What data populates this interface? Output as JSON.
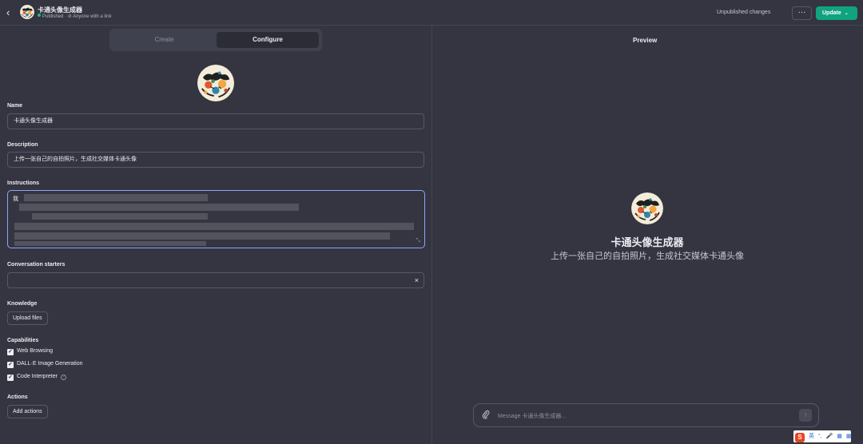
{
  "header": {
    "back_icon": "chevron-left-icon",
    "gpt_name": "卡通头像生成器",
    "status": "Published",
    "status_color": "#19c37d",
    "visibility": "Anyone with a link",
    "unpublished": "Unpublished changes",
    "more_label": "···",
    "update_label": "Update",
    "update_color": "#10a37f"
  },
  "tabs": [
    {
      "label": "Create",
      "active": false
    },
    {
      "label": "Configure",
      "active": true
    }
  ],
  "form": {
    "name_label": "Name",
    "name_value": "卡通头像生成器",
    "description_label": "Description",
    "description_value": "上传一张自己的自拍照片，生成社交媒体卡通头像",
    "instructions_label": "Instructions",
    "instructions_visible": "我",
    "conversation_starters_label": "Conversation starters",
    "conversation_starter_value": "",
    "clear_icon": "close-icon",
    "knowledge_label": "Knowledge",
    "upload_label": "Upload files",
    "capabilities_label": "Capabilities",
    "capabilities": [
      {
        "label": "Web Browsing",
        "checked": true
      },
      {
        "label": "DALL·E Image Generation",
        "checked": true
      },
      {
        "label": "Code Interpreter",
        "checked": true
      }
    ],
    "actions_label": "Actions",
    "add_actions_label": "Add actions"
  },
  "preview": {
    "title": "Preview",
    "name": "卡通头像生成器",
    "description": "上传一张自己的自拍照片，生成社交媒体卡通头像",
    "message_placeholder": "Message 卡通头像生成器…",
    "attach_icon": "paperclip-icon",
    "send_icon": "arrow-up-icon"
  },
  "ime": {
    "logo": "S",
    "items": [
      "英",
      "°,",
      "🎤",
      "▦",
      "▦"
    ]
  }
}
